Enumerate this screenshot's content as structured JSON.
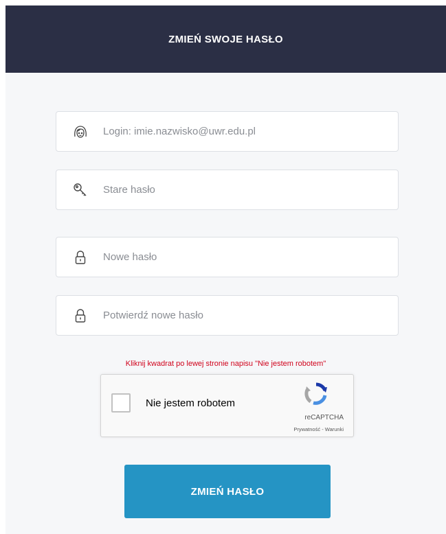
{
  "header": {
    "title": "ZMIEŃ SWOJE HASŁO"
  },
  "form": {
    "login_placeholder": "Login: imie.nazwisko@uwr.edu.pl",
    "old_password_placeholder": "Stare hasło",
    "new_password_placeholder": "Nowe hasło",
    "confirm_password_placeholder": "Potwierdź nowe hasło"
  },
  "captcha": {
    "hint": "Kliknij kwadrat po lewej stronie napisu \"Nie jestem robotem\"",
    "label": "Nie jestem robotem",
    "brand": "reCAPTCHA",
    "links": "Prywatność - Warunki"
  },
  "submit": {
    "label": "ZMIEŃ HASŁO"
  },
  "colors": {
    "header_bg": "#2b2f45",
    "button_bg": "#2594c4",
    "hint_text": "#d0021b"
  },
  "icons": {
    "login": "user-face-icon",
    "old_password": "key-icon",
    "new_password": "padlock-icon",
    "confirm_password": "padlock-icon"
  }
}
